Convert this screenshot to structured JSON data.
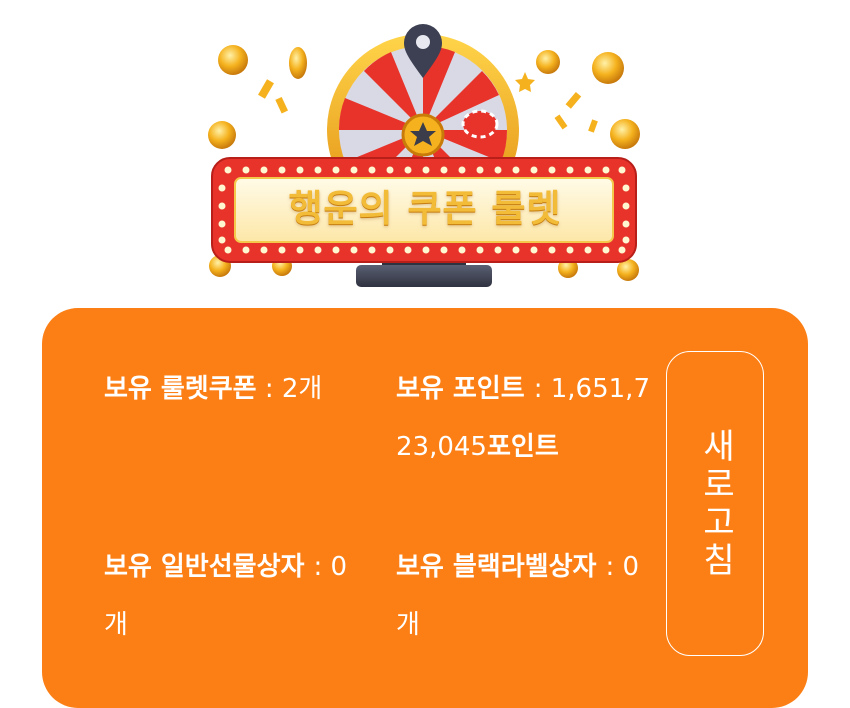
{
  "banner": {
    "title": "행운의 쿠폰 룰렛"
  },
  "info": {
    "roulette_coupons": {
      "label": "보유 룰렛쿠폰",
      "sep": " : ",
      "value": "2개"
    },
    "points": {
      "label": "보유 포인트 ",
      "sep": ": ",
      "value": "1,651,723,045",
      "unit": "포인트"
    },
    "normal_gift_box": {
      "label": "보유 일반선물상자 ",
      "sep": ": ",
      "value": "0개"
    },
    "black_label_box": {
      "label": "보유 블랙라벨상자 ",
      "sep": ": ",
      "value": "0개"
    }
  },
  "refresh_button": {
    "label": "새로고침"
  },
  "colors": {
    "card_bg": "#fc7f15",
    "banner_text": "#f2bb38",
    "wheel_red": "#e8332b",
    "wheel_light": "#d9d9e6",
    "gold": "#f5b21e"
  },
  "icons": [
    "roulette-wheel-icon",
    "gold-coin-icon",
    "map-pin-icon",
    "star-icon",
    "poker-chip-icon"
  ]
}
